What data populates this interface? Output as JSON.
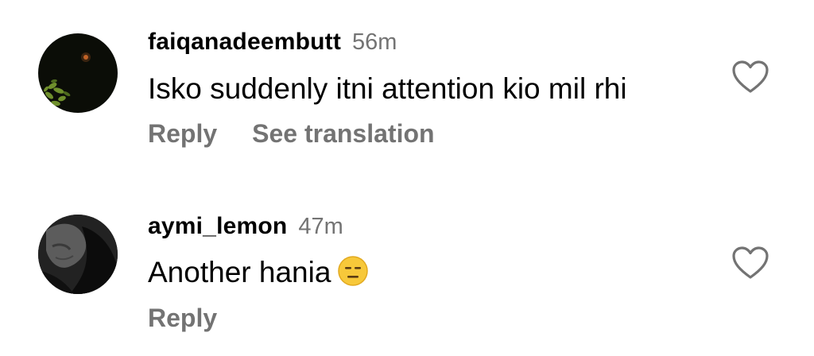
{
  "comments": [
    {
      "username": "faiqanadeembutt",
      "time": "56m",
      "text": "Isko suddenly itni attention kio mil rhi",
      "actions": {
        "reply": "Reply",
        "see_translation": "See translation"
      }
    },
    {
      "username": "aymi_lemon",
      "time": "47m",
      "text": "Another hania",
      "emoji": "expressionless-face-emoji",
      "actions": {
        "reply": "Reply"
      }
    }
  ],
  "icons": {
    "like": "heart-outline-icon"
  },
  "colors": {
    "primary_text": "#000000",
    "secondary_text": "#737373"
  }
}
